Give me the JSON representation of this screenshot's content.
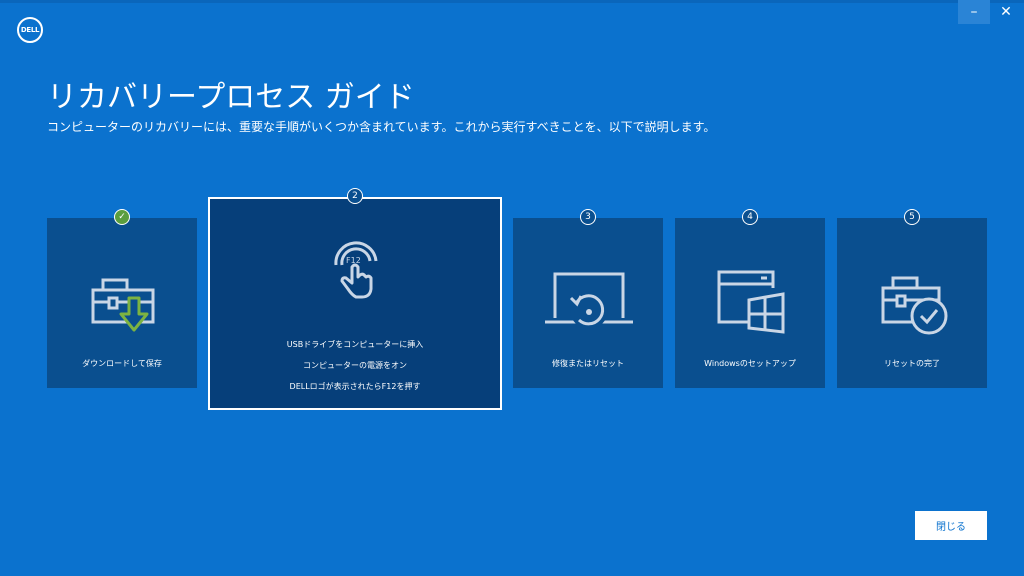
{
  "app": {
    "logo_text": "DELL"
  },
  "window": {
    "minimize": "–",
    "close": "✕"
  },
  "header": {
    "title": "リカバリープロセス ガイド",
    "subtitle": "コンピューターのリカバリーには、重要な手順がいくつか含まれています。これから実行すべきことを、以下で説明します。"
  },
  "steps": [
    {
      "badge": "✓",
      "label": "ダウンロードして保存",
      "icon": "toolbox-download-icon",
      "status": "done"
    },
    {
      "badge": "2",
      "lines": [
        "USBドライブをコンピューターに挿入",
        "コンピューターの電源をオン",
        "DELLロゴが表示されたらF12を押す"
      ],
      "icon_text": "F12",
      "icon": "tap-f12-icon",
      "status": "active"
    },
    {
      "badge": "3",
      "label": "修復またはリセット",
      "icon": "laptop-reset-icon",
      "status": "pending"
    },
    {
      "badge": "4",
      "label": "Windowsのセットアップ",
      "icon": "windows-setup-icon",
      "status": "pending"
    },
    {
      "badge": "5",
      "label": "リセットの完了",
      "icon": "toolbox-check-icon",
      "status": "pending"
    }
  ],
  "footer": {
    "close_label": "閉じる"
  },
  "colors": {
    "background": "#0B72CE",
    "card": "#0A4F8F",
    "active_card": "#063F7A",
    "done": "#5B9E3F",
    "icon_stroke": "#C9D6E6"
  }
}
